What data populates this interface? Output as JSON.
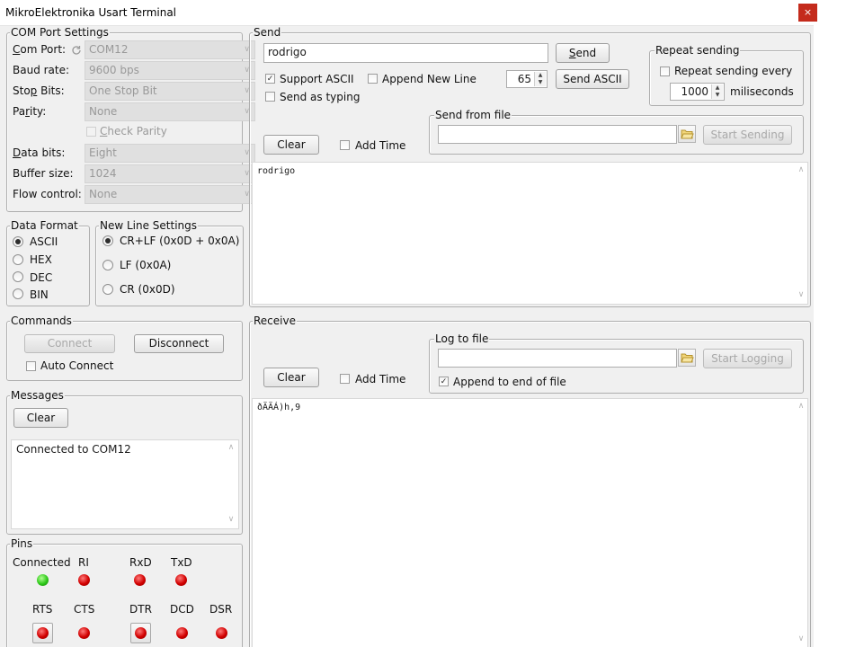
{
  "window": {
    "title": "MikroElektronika Usart Terminal",
    "close_glyph": "×"
  },
  "com_port": {
    "title": "COM Port Settings",
    "port_label_pre": "",
    "port_label_u": "C",
    "port_label_post": "om Port:",
    "port_value": "COM12",
    "baud_label": "Baud rate:",
    "baud_value": "9600 bps",
    "stop_label_pre": "Sto",
    "stop_label_u": "p",
    "stop_label_post": " Bits:",
    "stop_value": "One Stop Bit",
    "parity_label_pre": "Pa",
    "parity_label_u": "r",
    "parity_label_post": "ity:",
    "parity_value": "None",
    "check_parity_u": "C",
    "check_parity_post": "heck Parity",
    "data_bits_label_pre": "",
    "data_bits_label_u": "D",
    "data_bits_label_post": "ata bits:",
    "data_bits_value": "Eight",
    "buffer_label": "Buffer size:",
    "buffer_value": "1024",
    "flow_label": "Flow control:",
    "flow_value": "None"
  },
  "data_format": {
    "title": "Data Format",
    "options": [
      "ASCII",
      "HEX",
      "DEC",
      "BIN"
    ],
    "selected": "ASCII"
  },
  "new_line": {
    "title": "New Line Settings",
    "options": [
      "CR+LF (0x0D + 0x0A)",
      "LF (0x0A)",
      "CR (0x0D)"
    ],
    "selected": "CR+LF (0x0D + 0x0A)"
  },
  "commands": {
    "title": "Commands",
    "connect": "Connect",
    "disconnect": "Disconnect",
    "auto_connect": "Auto Connect"
  },
  "messages": {
    "title": "Messages",
    "clear": "Clear",
    "text": "Connected to COM12"
  },
  "pins": {
    "title": "Pins",
    "row1": [
      {
        "label": "Connected",
        "state": "green"
      },
      {
        "label": "RI",
        "state": "red"
      },
      {
        "label": "RxD",
        "state": "red"
      },
      {
        "label": "TxD",
        "state": "red"
      }
    ],
    "row2": [
      {
        "label": "RTS",
        "state": "red",
        "button": true
      },
      {
        "label": "CTS",
        "state": "red",
        "button": false
      },
      {
        "label": "DTR",
        "state": "red",
        "button": true
      },
      {
        "label": "DCD",
        "state": "red",
        "button": false
      },
      {
        "label": "DSR",
        "state": "red",
        "button": false
      }
    ]
  },
  "send": {
    "title": "Send",
    "input_value": "rodrigo",
    "send_button_u": "S",
    "send_button_post": "end",
    "support_ascii": "Support ASCII",
    "support_ascii_checked": true,
    "append_new_line": "Append New Line",
    "ascii_value": "65",
    "send_ascii_button": "Send ASCII",
    "send_as_typing": "Send as typing",
    "clear": "Clear",
    "add_time": "Add Time",
    "text": "rodrigo"
  },
  "repeat": {
    "title": "Repeat sending",
    "checkbox": "Repeat sending every",
    "value": "1000",
    "unit": "miliseconds"
  },
  "send_file": {
    "title": "Send from file",
    "path": "",
    "button": "Start Sending"
  },
  "receive": {
    "title": "Receive",
    "clear": "Clear",
    "add_time": "Add Time",
    "text": "ðÄÄÁ)h,9"
  },
  "log_file": {
    "title": "Log to file",
    "path": "",
    "button": "Start Logging",
    "append": "Append to end of file",
    "append_checked": true
  }
}
